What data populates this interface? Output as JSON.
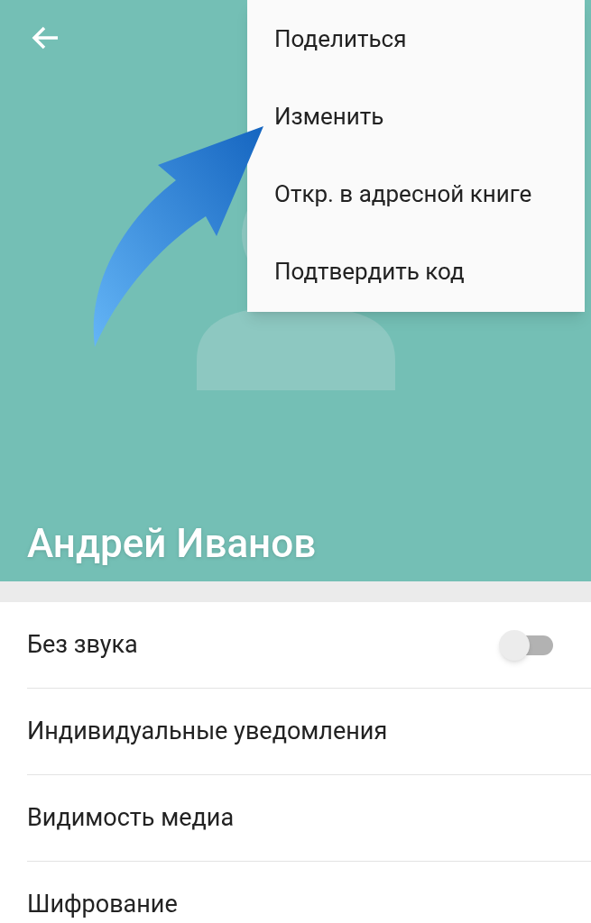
{
  "contact": {
    "name": "Андрей Иванов"
  },
  "menu": [
    {
      "label": "Поделиться"
    },
    {
      "label": "Изменить"
    },
    {
      "label": "Откр. в адресной книге"
    },
    {
      "label": "Подтвердить код"
    }
  ],
  "settings": [
    {
      "kind": "toggle",
      "label": "Без звука",
      "on": false
    },
    {
      "kind": "plain",
      "label": "Индивидуальные уведомления"
    },
    {
      "kind": "plain",
      "label": "Видимость медиа"
    },
    {
      "kind": "plain",
      "label": "Шифрование"
    }
  ]
}
